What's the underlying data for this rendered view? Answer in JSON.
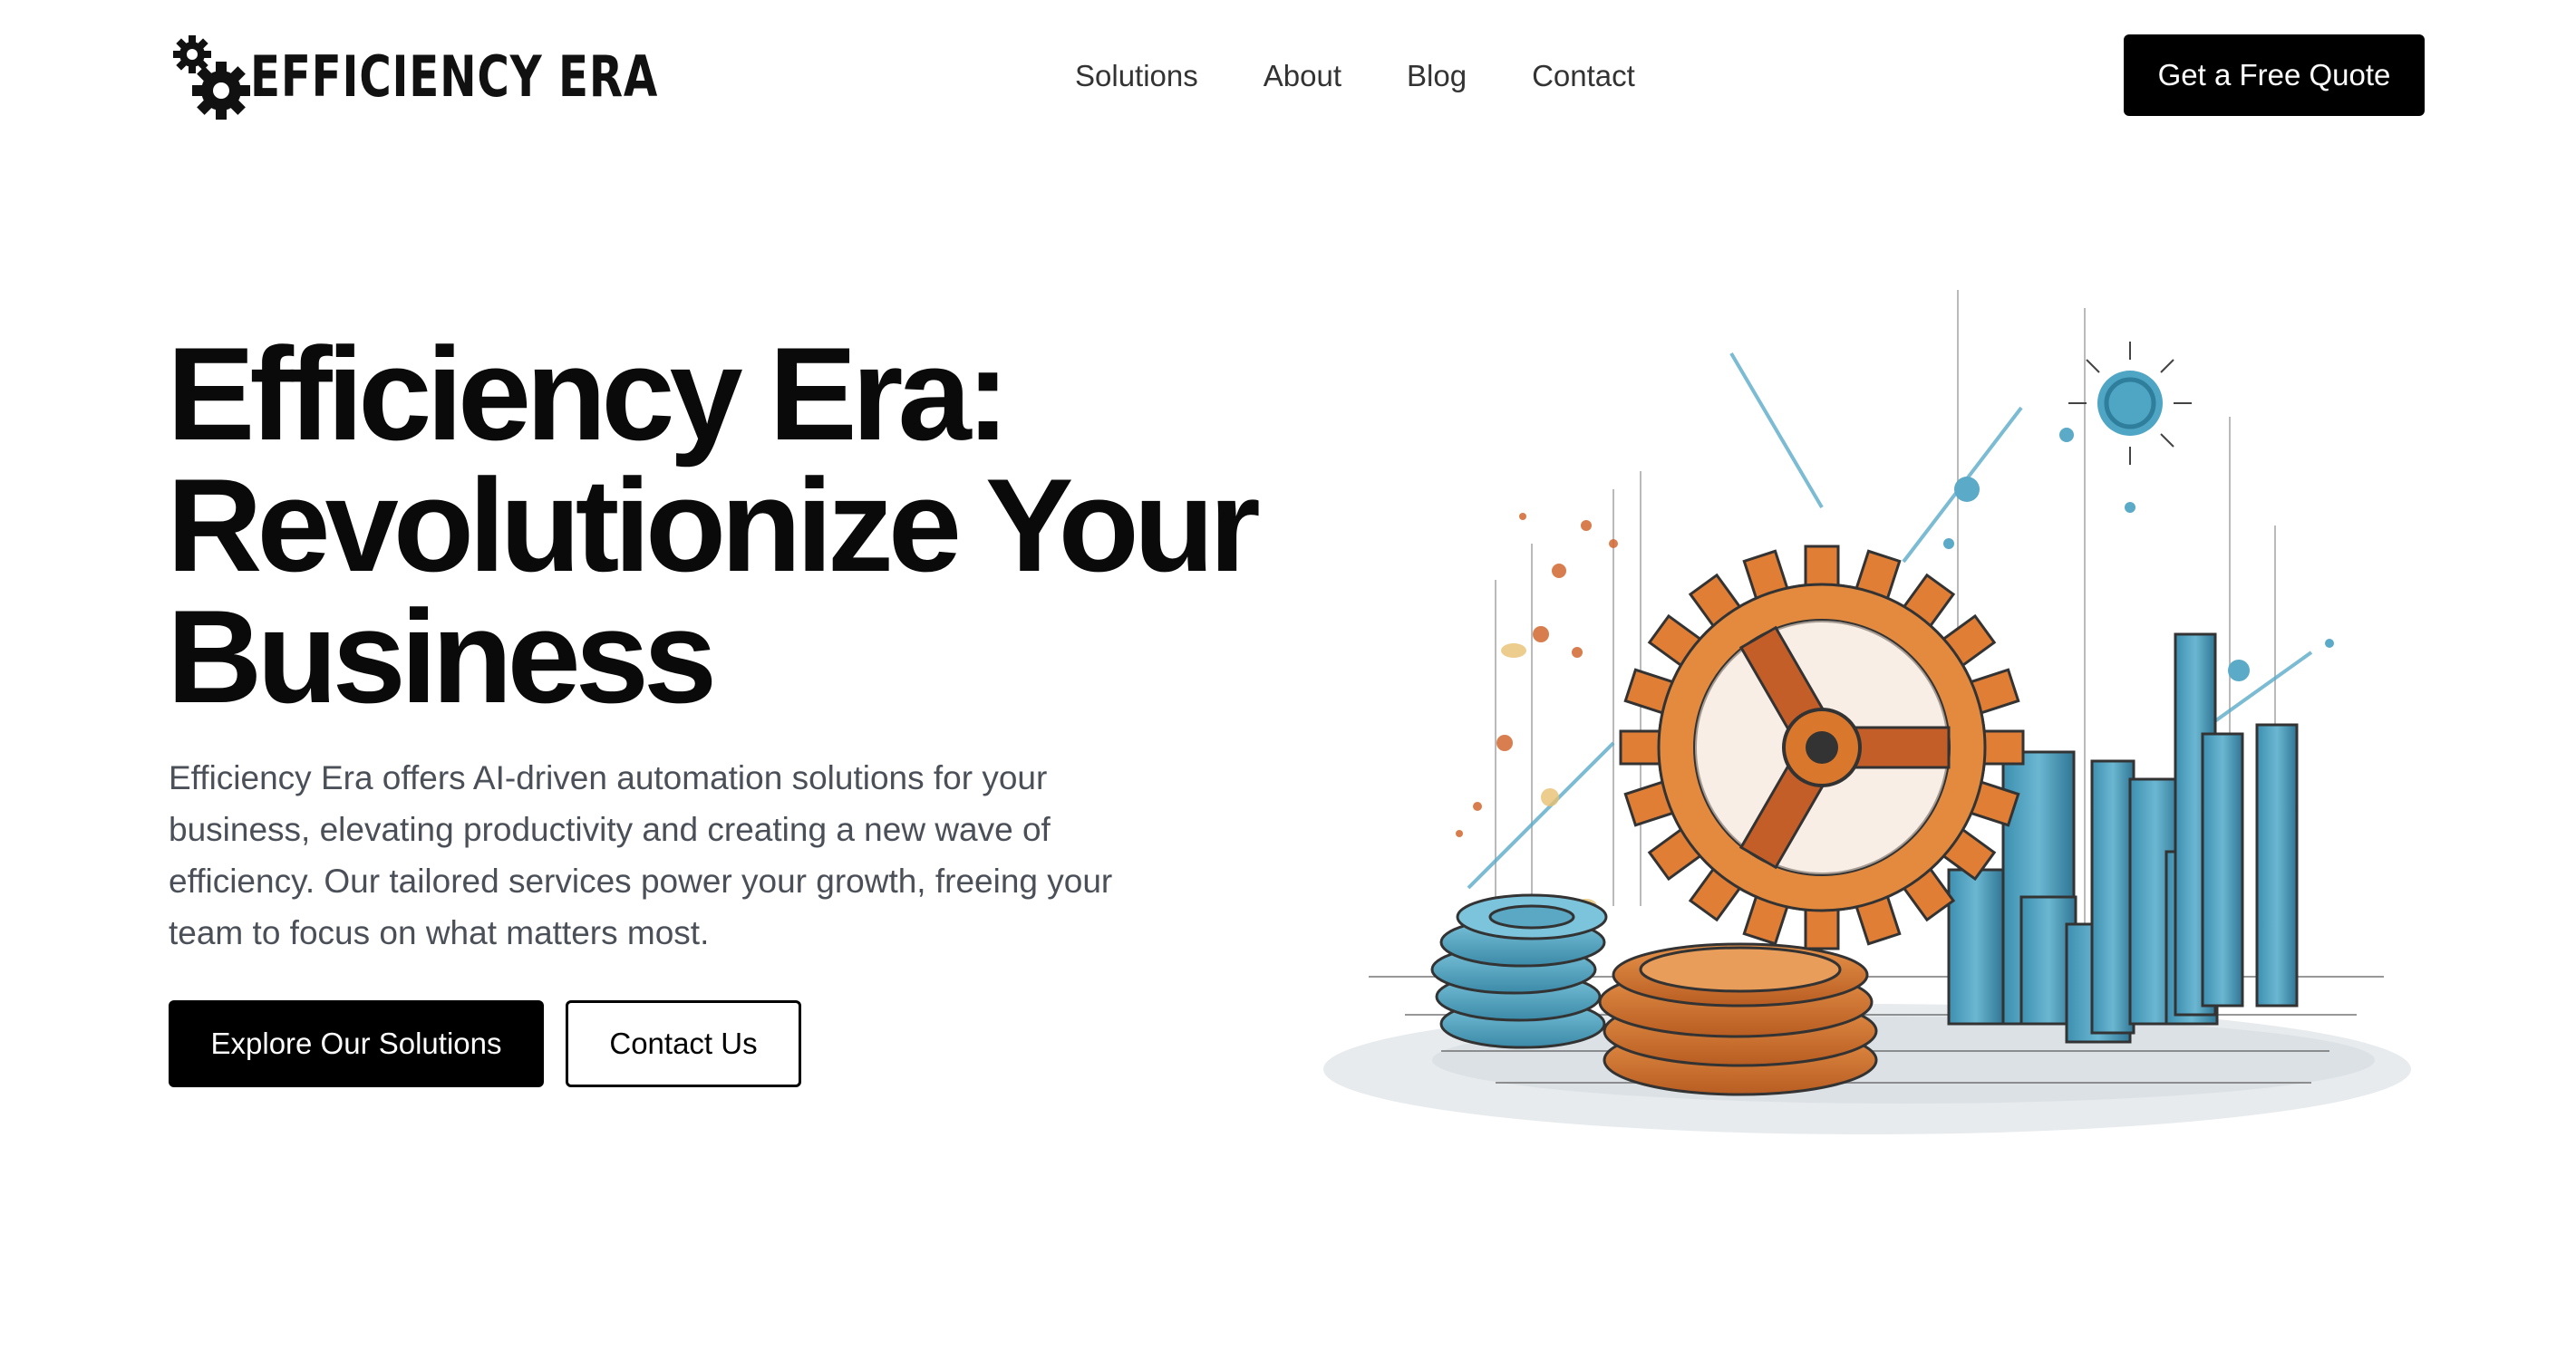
{
  "brand": {
    "logo_text": "EFFICIENCY ERA",
    "logo_icon": "gears-icon"
  },
  "nav": {
    "items": [
      {
        "label": "Solutions"
      },
      {
        "label": "About"
      },
      {
        "label": "Blog"
      },
      {
        "label": "Contact"
      }
    ],
    "cta_label": "Get a Free Quote"
  },
  "hero": {
    "title_line1": "Efficiency Era:",
    "title_line2": "Revolutionize Your",
    "title_line3": "Business",
    "description": "Efficiency Era offers AI-driven automation solutions for your business, elevating productivity and creating a new wave of efficiency. Our tailored services power your growth, freeing your team to focus on what matters most.",
    "primary_button": "Explore Our Solutions",
    "secondary_button": "Contact Us",
    "illustration": "gear-and-bar-chart-illustration"
  },
  "colors": {
    "text_primary": "#0a0a0a",
    "text_secondary": "#4a4f58",
    "button_bg": "#000000",
    "accent_orange": "#d9782d",
    "accent_teal": "#4a9fbf"
  }
}
